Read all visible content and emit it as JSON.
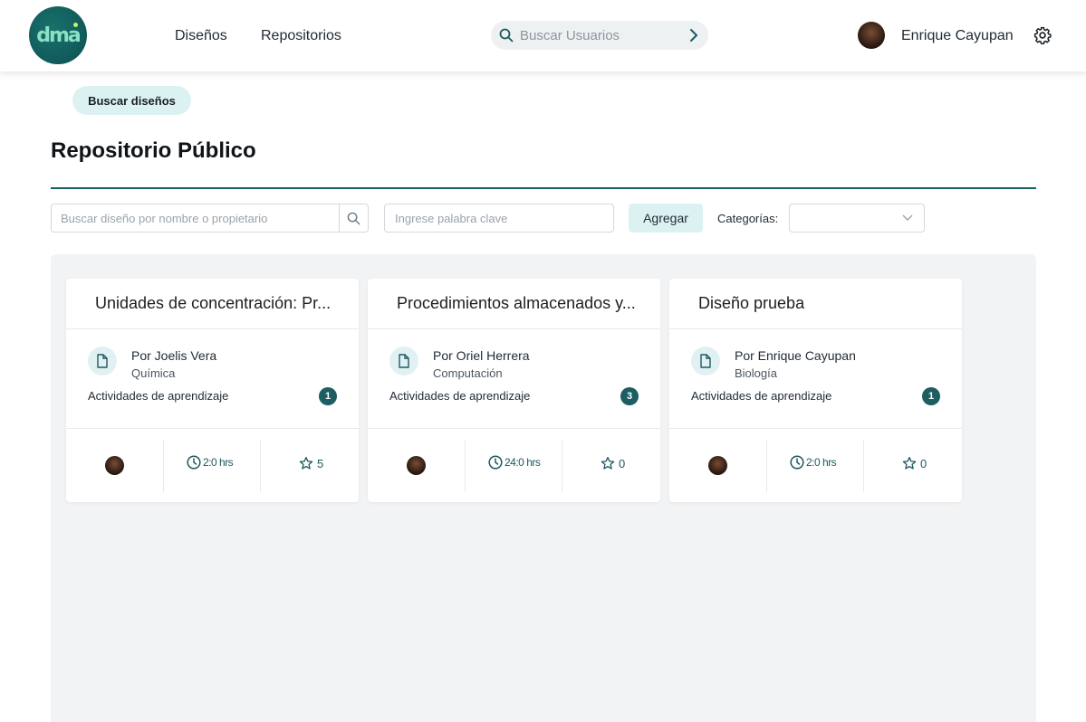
{
  "header": {
    "logo_text": "dma",
    "nav": [
      "Diseños",
      "Repositorios"
    ],
    "search_placeholder": "Buscar Usuarios",
    "user_name": "Enrique Cayupan"
  },
  "toolbar": {
    "search_designs_label": "Buscar diseños"
  },
  "page": {
    "title": "Repositorio Público"
  },
  "filters": {
    "name_search_placeholder": "Buscar diseño por nombre o propietario",
    "keyword_placeholder": "Ingrese palabra clave",
    "add_label": "Agregar",
    "categories_label": "Categorías:",
    "category_value": ""
  },
  "cards": [
    {
      "title": "Unidades de concentración: Pr...",
      "owner": "Por Joelis Vera",
      "category": "Química",
      "activities_label": "Actividades de aprendizaje",
      "activities_count": "1",
      "hours": "2:0 hrs",
      "stars": "5"
    },
    {
      "title": "Procedimientos almacenados y...",
      "owner": "Por Oriel Herrera",
      "category": "Computación",
      "activities_label": "Actividades de aprendizaje",
      "activities_count": "3",
      "hours": "24:0 hrs",
      "stars": "0"
    },
    {
      "title": "Diseño prueba",
      "owner": "Por Enrique Cayupan",
      "category": "Biología",
      "activities_label": "Actividades de aprendizaje",
      "activities_count": "1",
      "hours": "2:0 hrs",
      "stars": "0"
    }
  ],
  "colors": {
    "accent": "#175e66",
    "pill_bg": "#dcf2f2",
    "badge": "#1c5e62",
    "grid_bg": "#f2f3f4"
  },
  "icons": [
    "search-icon",
    "chevron-right-icon",
    "gear-icon",
    "document-icon",
    "clock-icon",
    "star-icon",
    "chevron-down-icon"
  ]
}
